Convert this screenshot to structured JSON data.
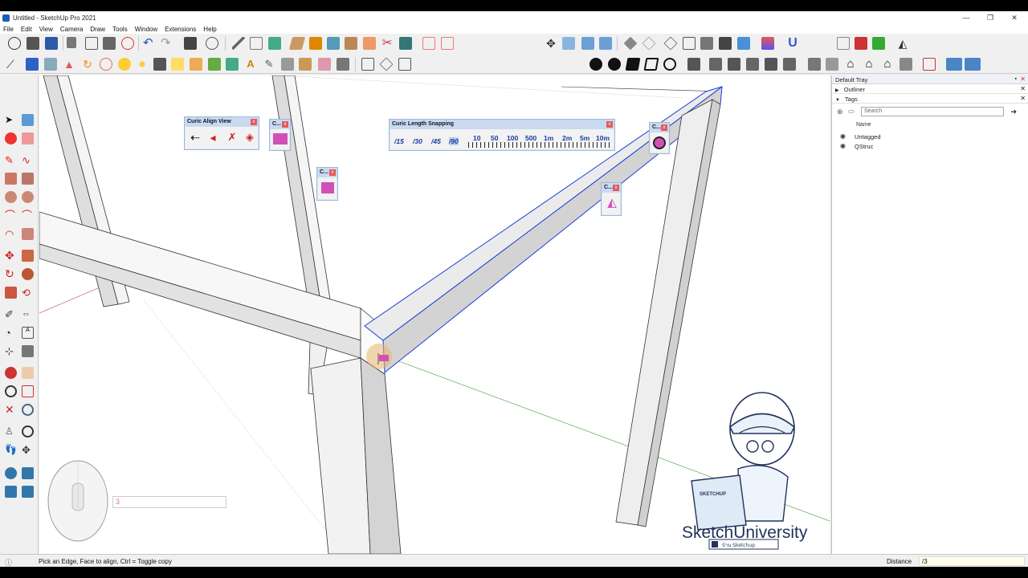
{
  "window": {
    "title": "Untitled - SketchUp Pro 2021",
    "controls": [
      "—",
      "❐",
      "✕"
    ]
  },
  "menu": [
    "File",
    "Edit",
    "View",
    "Camera",
    "Draw",
    "Tools",
    "Window",
    "Extensions",
    "Help"
  ],
  "float_toolbars": {
    "align_view": {
      "title": "Curic Align View"
    },
    "small_1": {
      "title": "C..."
    },
    "small_2": {
      "title": "C..."
    },
    "small_3": {
      "title": "C..."
    },
    "small_4": {
      "title": "C..."
    },
    "length_snapping": {
      "title": "Curic Length Snapping",
      "angles": [
        "/15",
        "/30",
        "/45",
        "/90"
      ],
      "lengths": [
        "10",
        "50",
        "100",
        "500",
        "1m",
        "2m",
        "5m",
        "10m"
      ]
    }
  },
  "tray": {
    "title": "Default Tray",
    "outliner": "Outliner",
    "tags": "Tags",
    "search_placeholder": "Search",
    "column_name": "Name",
    "tag_items": [
      "Untagged",
      "QStruc"
    ]
  },
  "viewport": {
    "input_value": "3",
    "watermark_brand": "SketchUniversity",
    "watermark_sub": "บ้าน Sketchup",
    "laptop_label": "SKETCHUP"
  },
  "status": {
    "message": "Pick an Edge, Face to align, Ctrl = Toggle copy",
    "vcb_label": "Distance",
    "vcb_value": "/3"
  },
  "colors": {
    "accent_blue": "#1b3fd8",
    "axis_red": "#d04040",
    "axis_green": "#3a9a3a",
    "float_header": "#c9daf0"
  }
}
